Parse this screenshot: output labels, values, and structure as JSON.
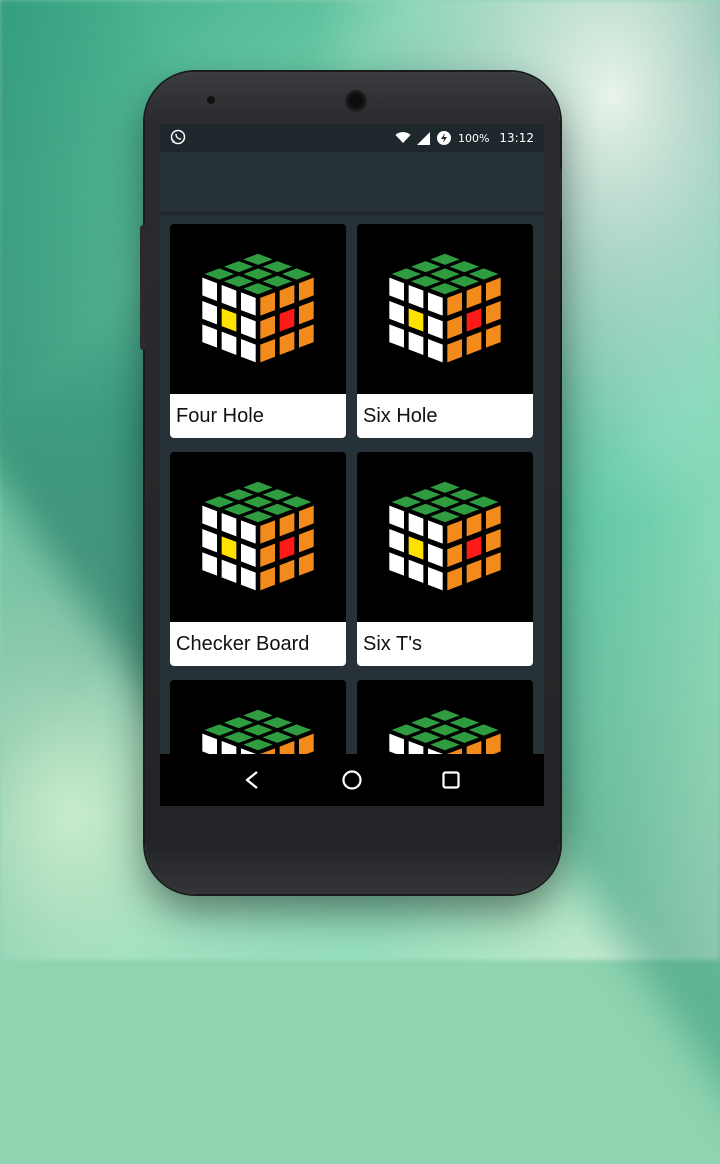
{
  "status_bar": {
    "battery": "100%",
    "time": "13:12",
    "icons": [
      "whatsapp-icon",
      "wifi-icon",
      "signal-icon",
      "battery-saver-icon"
    ]
  },
  "app_bar": {
    "title": ""
  },
  "patterns": [
    {
      "label": "Four Hole"
    },
    {
      "label": "Six Hole"
    },
    {
      "label": "Checker Board"
    },
    {
      "label": "Six T's"
    },
    {
      "label": ""
    },
    {
      "label": ""
    }
  ],
  "nav": {
    "back": "back-icon",
    "home": "home-icon",
    "recents": "recents-icon"
  },
  "colors": {
    "cube_top": "#2e9c3f",
    "cube_left": "#ffffff",
    "cube_right": "#f28a1c",
    "yellow": "#ffe100",
    "red": "#ff1a1a"
  }
}
